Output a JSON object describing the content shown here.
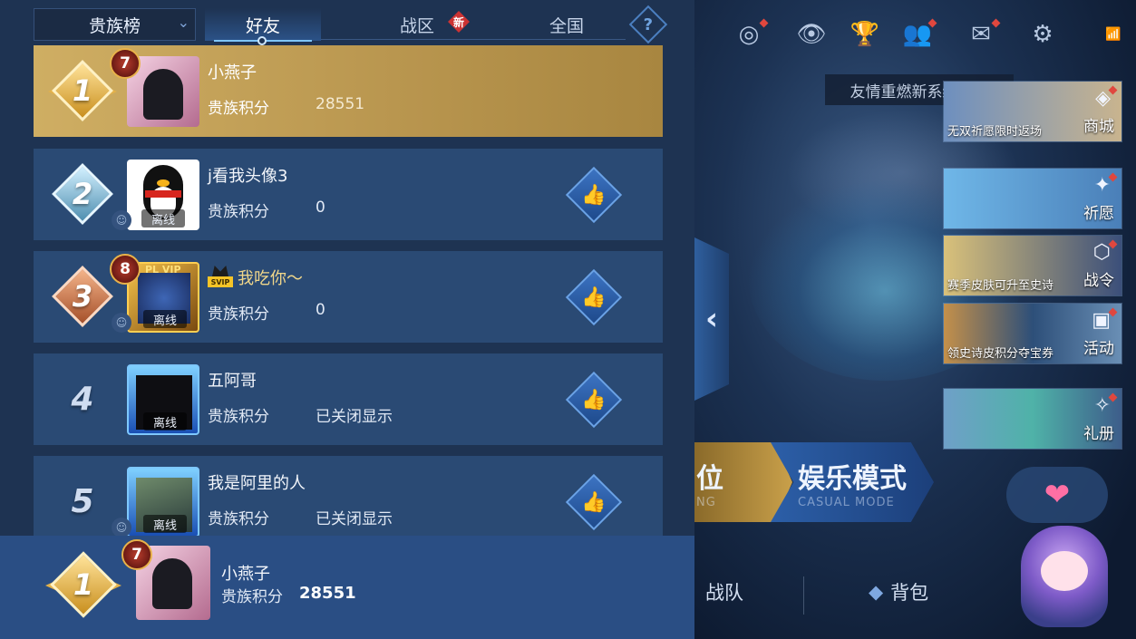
{
  "header": {
    "dropdown_label": "贵族榜",
    "tabs": [
      {
        "label": "好友",
        "active": true
      },
      {
        "label": "战区",
        "badge": "新"
      },
      {
        "label": "全国"
      }
    ],
    "help_icon": "?"
  },
  "score_label": "贵族积分",
  "status_offline": "离线",
  "rows": [
    {
      "rank": "1",
      "level": "7",
      "name": "小燕子",
      "score": "28551",
      "offline": false
    },
    {
      "rank": "2",
      "name": "j看我头像3",
      "score": "0",
      "offline": true
    },
    {
      "rank": "3",
      "level": "8",
      "vip_tag": "PL VIP",
      "svip": "SVIP",
      "name": "我吃你～",
      "score": "0",
      "offline": true
    },
    {
      "rank": "4",
      "name": "五阿哥",
      "score": "已关闭显示",
      "offline": true
    },
    {
      "rank": "5",
      "name": "我是阿里的人",
      "score": "已关闭显示",
      "offline": true
    }
  ],
  "my_rank": {
    "rank": "1",
    "level": "7",
    "name": "小燕子",
    "score": "28551"
  },
  "game_ui": {
    "tooltip": "友情重燃新系统上线",
    "side_banners": [
      {
        "caption": "无双祈愿限时返场",
        "label": "商城"
      },
      {
        "caption": "",
        "label": "祈愿"
      },
      {
        "caption": "赛季皮肤可升至史诗",
        "label": "战令"
      },
      {
        "caption": "领史诗皮积分夺宝券",
        "label": "活动"
      },
      {
        "caption": "",
        "label": "礼册"
      }
    ],
    "rank_mode": {
      "title": "位",
      "subtitle": "NG"
    },
    "casual_mode": {
      "title": "娱乐模式",
      "subtitle": "CASUAL MODE"
    },
    "nav": {
      "team": "战队",
      "bag": "背包"
    }
  },
  "colors": {
    "accent_gold": "#cfae63",
    "row_bg": "#2a4a74",
    "panel_bg": "#1e3352"
  }
}
